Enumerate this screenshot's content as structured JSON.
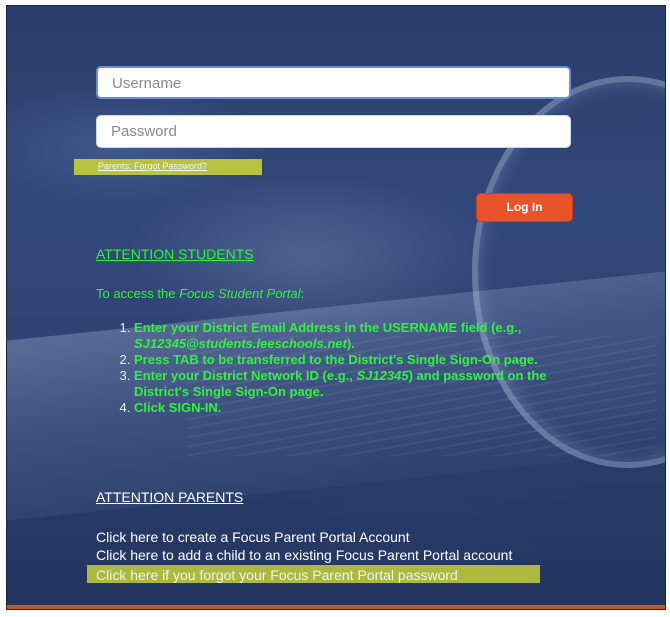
{
  "login": {
    "username_placeholder": "Username",
    "password_placeholder": "Password",
    "forgot_password_link": "Parents: Forgot Password?",
    "login_button": "Log In"
  },
  "students": {
    "heading": "ATTENTION STUDENTS",
    "intro_prefix": "To access the ",
    "intro_portal": "Focus Student Portal",
    "intro_suffix": ":",
    "steps": [
      {
        "a": "Enter your District Email Address in the USERNAME field (e.g., ",
        "em": "SJ12345@students.leeschools.net",
        "b": ")."
      },
      {
        "a": "Press TAB to be transferred to the District's Single Sign-On page.",
        "em": "",
        "b": ""
      },
      {
        "a": "Enter your District Network ID (e.g., ",
        "em": "SJ12345",
        "b": ") and password on the District's Single Sign-On page."
      },
      {
        "a": "Click SIGN-IN.",
        "em": "",
        "b": ""
      }
    ]
  },
  "parents": {
    "heading": "ATTENTION PARENTS",
    "create_account": "Click here to create a Focus Parent Portal Account",
    "add_child": "Click here to add a child to an existing Focus Parent Portal account",
    "forgot_password": "Click here if you forgot your Focus Parent Portal password"
  },
  "colors": {
    "accent_button": "#e8542a",
    "student_text": "#2ef53a",
    "highlight": "#c6cf3a",
    "background": "#2e4272"
  }
}
